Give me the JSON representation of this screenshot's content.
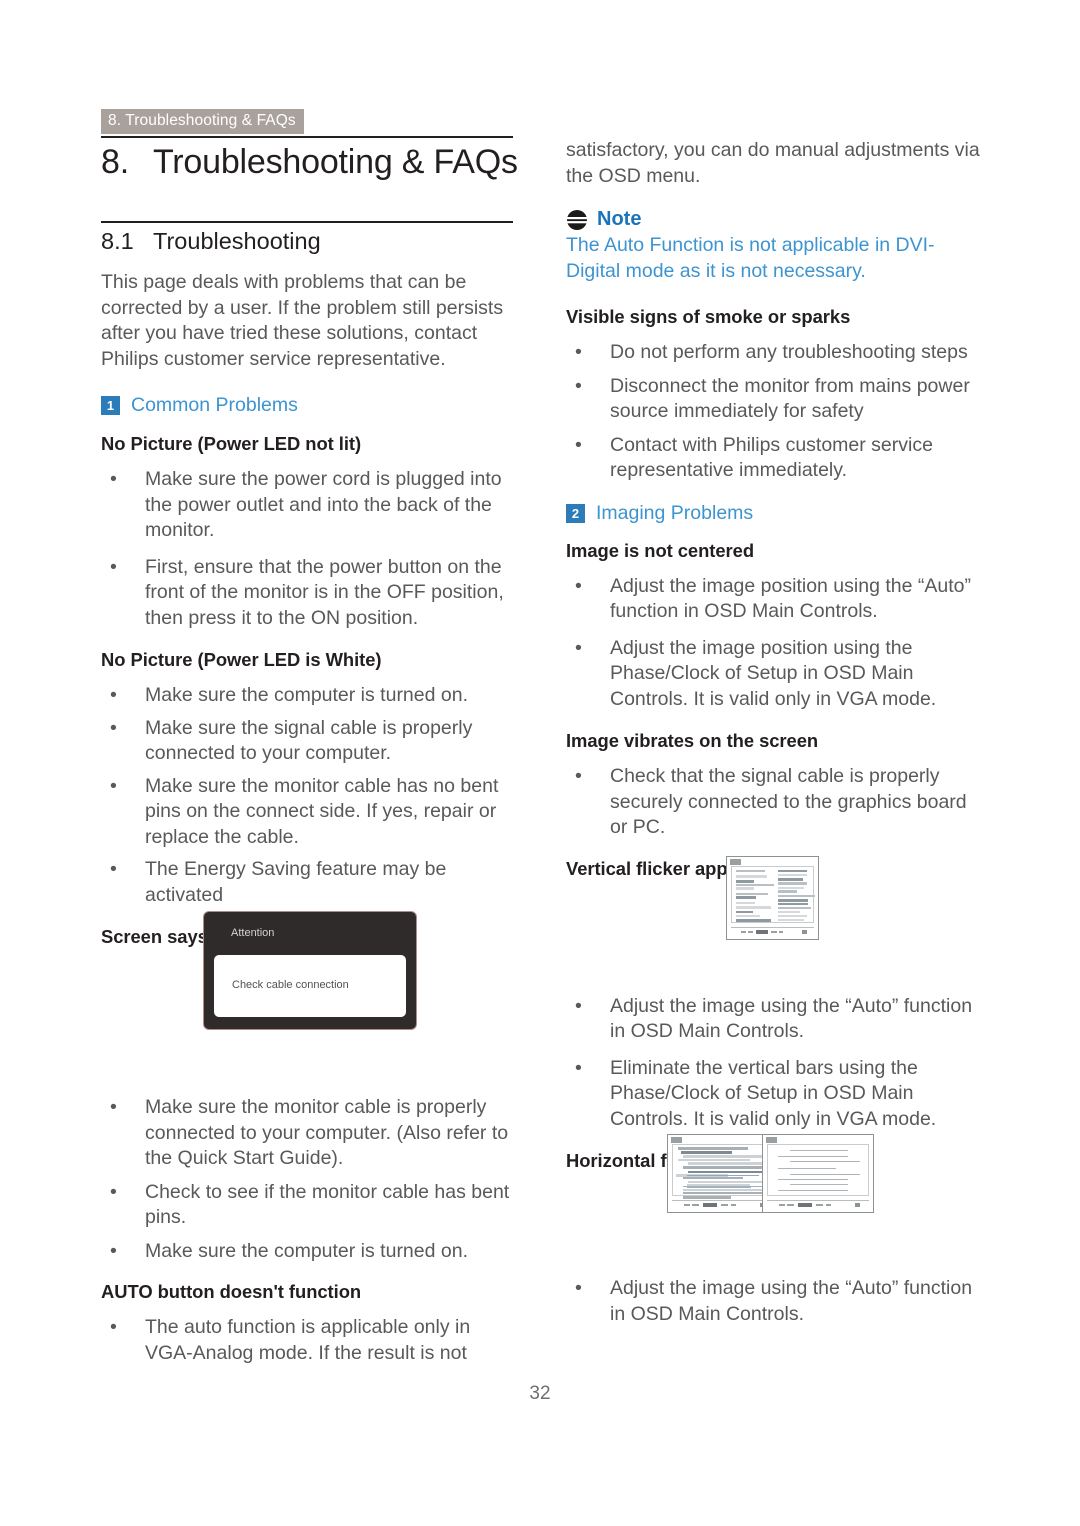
{
  "header": {
    "running_tab": "8. Troubleshooting & FAQs"
  },
  "chapter": {
    "number": "8.",
    "title": "Troubleshooting & FAQs"
  },
  "section": {
    "number": "8.1",
    "title": "Troubleshooting"
  },
  "left_column": {
    "intro": "This page deals with problems that can be corrected by a user. If the problem still persists after you have tried these solutions, contact Philips customer service representative.",
    "common_problems": {
      "badge": "1",
      "label": "Common Problems"
    },
    "no_picture_led_not_lit": {
      "heading": "No Picture (Power LED not lit)",
      "bullets": [
        "Make sure the power cord is plugged into the power outlet and into the back of the monitor.",
        "First, ensure that the power button on the front of the monitor is in the OFF position, then press it to the ON position."
      ]
    },
    "no_picture_led_white": {
      "heading": "No Picture (Power LED is White)",
      "bullets": [
        "Make sure the computer is turned on.",
        "Make sure the signal cable is properly connected to your computer.",
        "Make sure the monitor cable has no bent pins on the connect side. If yes, repair or replace the cable.",
        "The Energy Saving feature may be activated"
      ]
    },
    "screen_says": {
      "heading": "Screen says",
      "osd": {
        "title": "Attention",
        "message": "Check cable connection"
      },
      "bullets": [
        "Make sure the monitor cable is properly connected to your computer. (Also refer to the Quick Start Guide).",
        "Check to see if the monitor cable has bent pins.",
        "Make sure the computer is turned on."
      ]
    },
    "auto_button": {
      "heading": "AUTO button doesn't function",
      "bullets": [
        "The auto function is applicable only in VGA-Analog mode.  If the result is not"
      ]
    }
  },
  "right_column": {
    "continuation": "satisfactory, you can do manual adjustments via the OSD menu.",
    "note": {
      "icon": "note-icon",
      "title": "Note",
      "body": "The Auto Function is not applicable in DVI-Digital mode as it is not necessary."
    },
    "smoke_sparks": {
      "heading": "Visible signs of smoke or sparks",
      "bullets": [
        "Do not perform any troubleshooting steps",
        "Disconnect the monitor from mains power source immediately for safety",
        "Contact with Philips customer service representative immediately."
      ]
    },
    "imaging_problems": {
      "badge": "2",
      "label": "Imaging Problems"
    },
    "image_not_centered": {
      "heading": "Image is not centered",
      "bullets": [
        "Adjust the image position using the “Auto” function in OSD Main Controls.",
        "Adjust the image position using the Phase/Clock of Setup in OSD Main Controls.  It is valid only in VGA mode."
      ]
    },
    "image_vibrates": {
      "heading": "Image vibrates on the screen",
      "bullets": [
        "Check that the signal cable is properly securely connected to the graphics board or PC."
      ]
    },
    "vertical_flicker": {
      "heading": "Vertical flicker appears",
      "figure_name": "vertical-flicker-illustration",
      "bullets": [
        "Adjust the image using the “Auto” function in OSD Main Controls.",
        "Eliminate the vertical bars using the Phase/Clock of Setup in OSD Main Controls. It is valid only in VGA mode."
      ]
    },
    "horizontal_flicker": {
      "heading": "Horizontal flicker appears",
      "figure_name": "horizontal-flicker-illustration",
      "bullets": [
        "Adjust the image using the “Auto” function in OSD Main Controls."
      ]
    }
  },
  "footer": {
    "page_number": "32"
  },
  "colors": {
    "tab_background": "#a9a29c",
    "accent_blue": "#3d94d1",
    "badge_blue": "#2b7cb8",
    "body_text": "#58595b",
    "heading_text": "#231f20",
    "osd_background": "#2f2b2a"
  }
}
